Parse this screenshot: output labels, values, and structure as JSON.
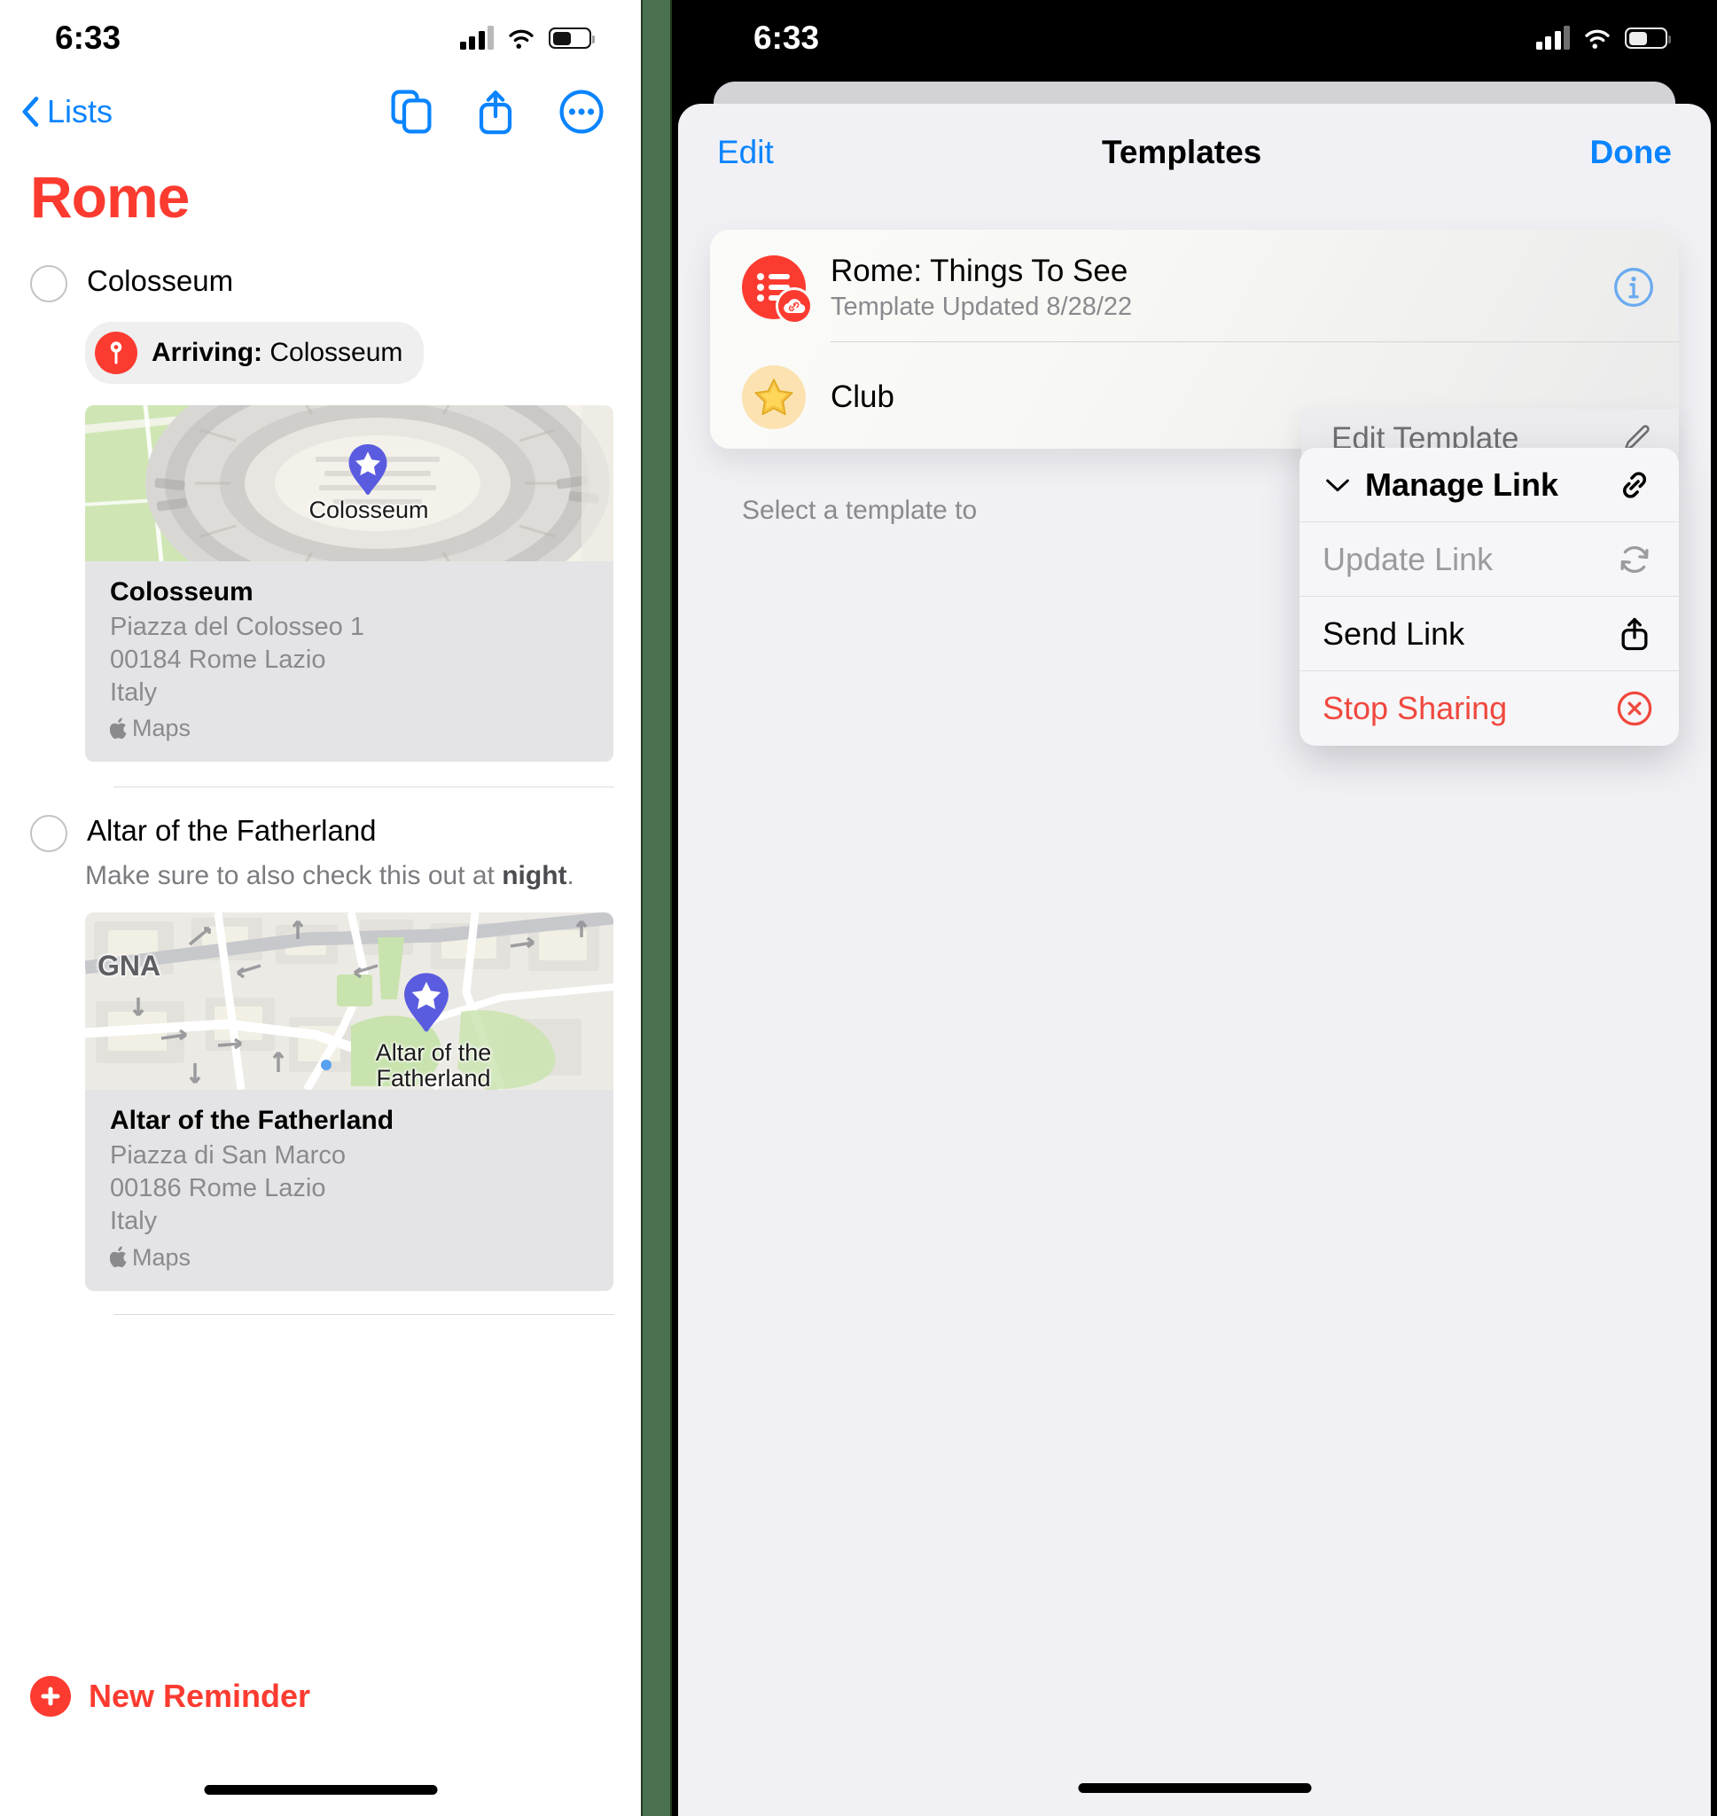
{
  "left": {
    "status": {
      "time": "6:33",
      "cellular_icon": "signal-bars-icon",
      "wifi_icon": "wifi-icon",
      "battery_icon": "battery-icon"
    },
    "nav": {
      "back_label": "Lists",
      "back_icon": "chevron-left-icon",
      "duplicate_icon": "duplicate-list-icon",
      "share_icon": "share-icon",
      "more_icon": "more-ellipsis-circle-icon"
    },
    "title": "Rome",
    "title_color": "#fc3b30",
    "reminders": [
      {
        "title": "Colosseum",
        "checkbox_icon": "circle-checkbox-icon",
        "chip": {
          "icon": "location-pin-icon",
          "prefix": "Arriving:",
          "value": "Colosseum"
        },
        "map": {
          "pin_icon": "star-map-pin-icon",
          "label": "Colosseum"
        },
        "address": {
          "name": "Colosseum",
          "lines": [
            "Piazza del Colosseo 1",
            "00184 Rome Lazio",
            "Italy"
          ],
          "attribution": "Maps",
          "attribution_icon": "apple-logo-icon"
        }
      },
      {
        "title": "Altar of the Fatherland",
        "checkbox_icon": "circle-checkbox-icon",
        "note_prefix": "Make sure to also check this out at ",
        "note_bold": "night",
        "note_suffix": ".",
        "map": {
          "pin_icon": "star-map-pin-icon",
          "label": "Altar of the\nFatherland",
          "street_label": "GNA"
        },
        "address": {
          "name": "Altar of the Fatherland",
          "lines": [
            "Piazza di San Marco",
            "00186 Rome Lazio",
            "Italy"
          ],
          "attribution": "Maps",
          "attribution_icon": "apple-logo-icon"
        }
      }
    ],
    "new_reminder": {
      "label": "New Reminder",
      "icon": "plus-circle-icon"
    }
  },
  "right": {
    "status": {
      "time": "6:33",
      "cellular_icon": "signal-bars-icon",
      "wifi_icon": "wifi-icon",
      "battery_icon": "battery-icon"
    },
    "sheet_nav": {
      "edit": "Edit",
      "title": "Templates",
      "done": "Done"
    },
    "templates": [
      {
        "name": "Rome: Things To See",
        "subtitle": "Template Updated 8/28/22",
        "icon": "reminders-list-icon",
        "badge_icon": "shared-link-cloud-icon",
        "info_icon": "info-circle-icon"
      },
      {
        "name": "Club",
        "icon": "star-emoji-icon"
      }
    ],
    "footnote": "Select a template to",
    "context_preview": {
      "label": "Edit Template",
      "icon": "pencil-icon"
    },
    "context_menu": [
      {
        "label": "Manage Link",
        "icon": "link-icon",
        "style": "strong",
        "leading_icon": "chevron-down-icon"
      },
      {
        "label": "Update Link",
        "icon": "refresh-icon",
        "style": "disabled"
      },
      {
        "label": "Send Link",
        "icon": "share-icon",
        "style": "normal"
      },
      {
        "label": "Stop Sharing",
        "icon": "x-circle-icon",
        "style": "danger"
      }
    ]
  },
  "colors": {
    "accent_red": "#fc3b30",
    "accent_blue": "#0a84ff",
    "split_green": "#4a7150"
  }
}
